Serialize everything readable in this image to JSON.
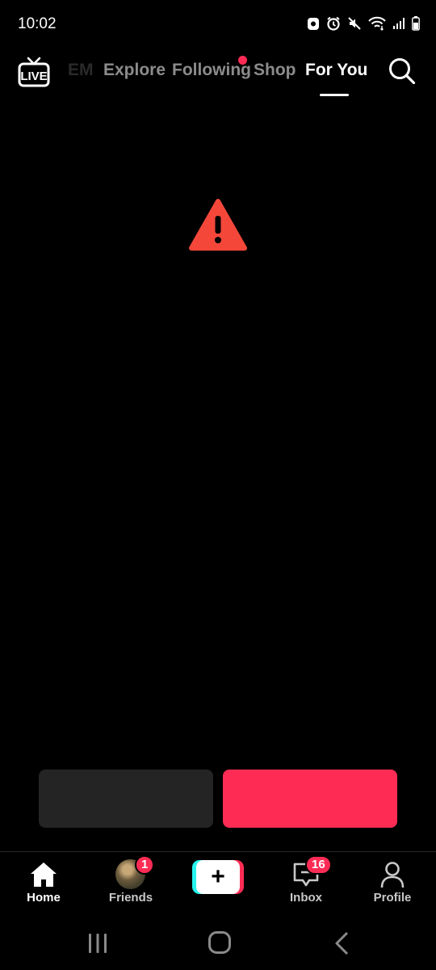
{
  "status_bar": {
    "time": "10:02",
    "icons": [
      "notification-icon",
      "alarm-icon",
      "mute-icon",
      "wifi-icon",
      "signal-icon",
      "battery-icon"
    ]
  },
  "top_nav": {
    "live_label": "LIVE",
    "tabs": [
      {
        "label": "EM",
        "state": "faded"
      },
      {
        "label": "Explore",
        "state": "inactive"
      },
      {
        "label": "Following",
        "state": "inactive",
        "has_dot": true
      },
      {
        "label": "Shop",
        "state": "inactive"
      },
      {
        "label": "For You",
        "state": "active"
      }
    ]
  },
  "content": {
    "warning_icon": "warning-triangle-icon",
    "warning_color": "#f4473a"
  },
  "actions": {
    "secondary_color": "#242424",
    "primary_color": "#fe2c55"
  },
  "bottom_nav": {
    "items": [
      {
        "label": "Home",
        "icon": "home-icon",
        "active": true
      },
      {
        "label": "Friends",
        "icon": "avatar",
        "badge": "1"
      },
      {
        "label": "",
        "icon": "create-plus-icon"
      },
      {
        "label": "Inbox",
        "icon": "inbox-icon",
        "badge": "16"
      },
      {
        "label": "Profile",
        "icon": "profile-icon"
      }
    ]
  },
  "system_nav": {
    "buttons": [
      "recent-apps-icon",
      "home-circle-icon",
      "back-icon"
    ]
  },
  "colors": {
    "accent": "#fe2c55",
    "accent_cyan": "#25f4ee",
    "background": "#000000"
  }
}
